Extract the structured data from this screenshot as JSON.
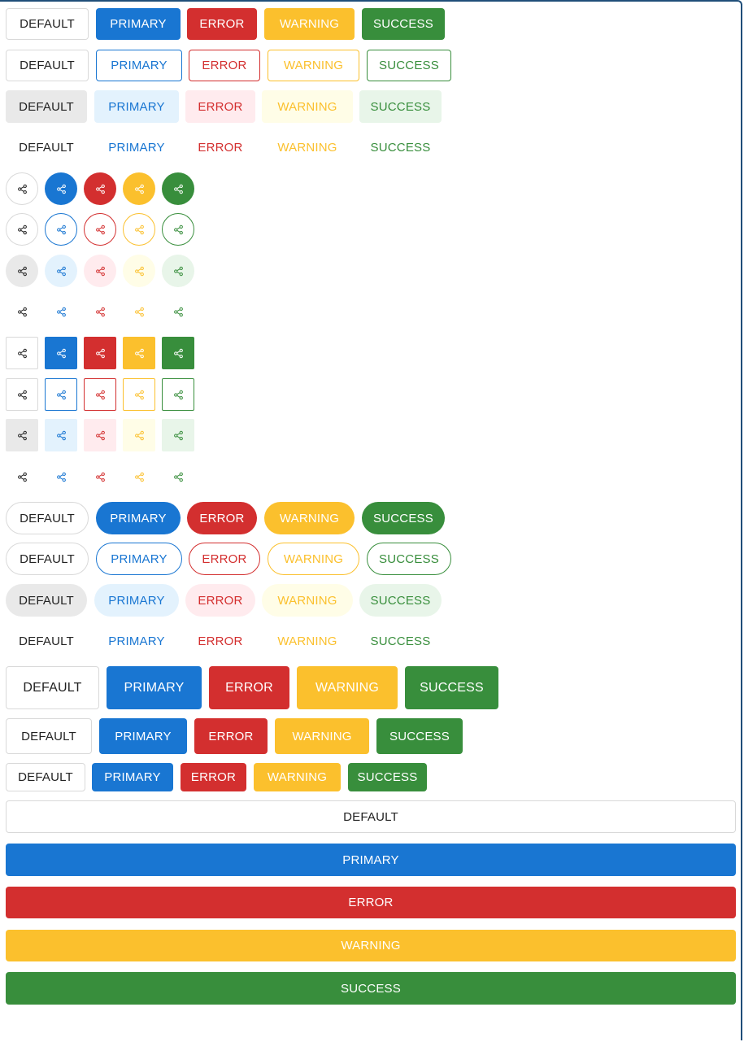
{
  "labels": {
    "default": "DEFAULT",
    "primary": "PRIMARY",
    "error": "ERROR",
    "warning": "WARNING",
    "success": "SUCCESS"
  },
  "icon": "share-icon",
  "colors": {
    "default": "#222222",
    "primary": "#1976d2",
    "error": "#d32f2f",
    "warning": "#fbc02d",
    "success": "#388e3c",
    "frame": "#1f4e79"
  }
}
